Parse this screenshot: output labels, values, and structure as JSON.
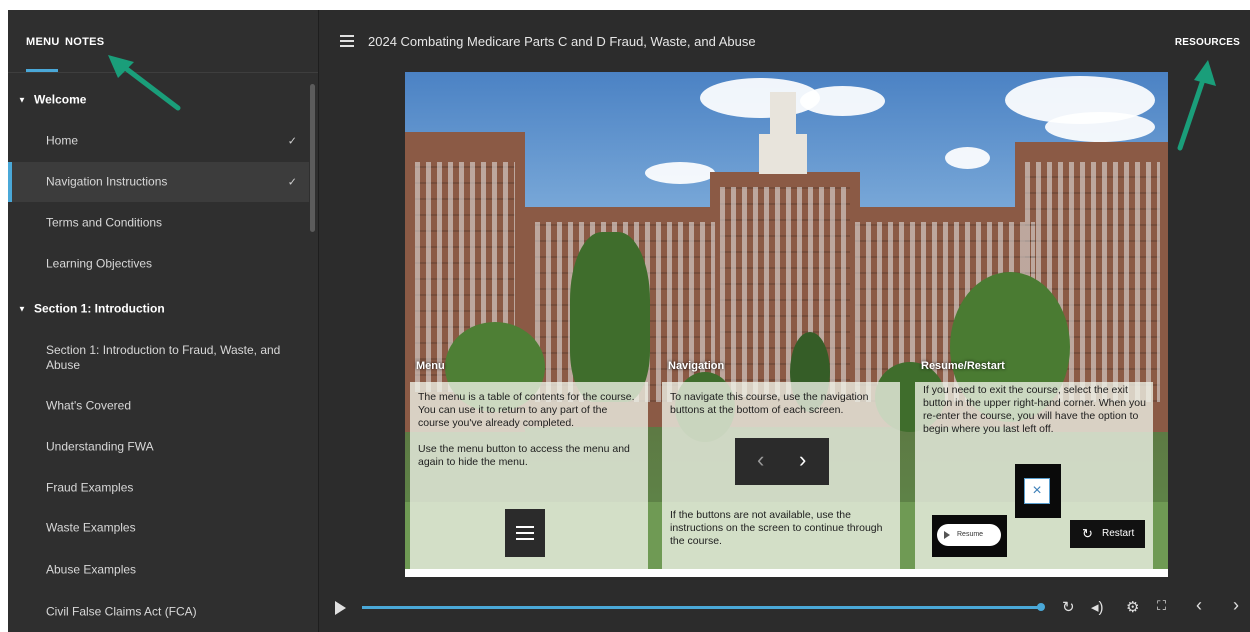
{
  "sidebar": {
    "tabs": [
      "MENU",
      "NOTES"
    ],
    "items": [
      {
        "label": "Welcome",
        "type": "section"
      },
      {
        "label": "Home",
        "type": "item",
        "completed": true
      },
      {
        "label": "Navigation Instructions",
        "type": "item",
        "completed": true,
        "active": true
      },
      {
        "label": "Terms and Conditions",
        "type": "item"
      },
      {
        "label": "Learning Objectives",
        "type": "item"
      },
      {
        "label": "Section 1: Introduction",
        "type": "section"
      },
      {
        "label": "Section 1: Introduction to Fraud, Waste, and Abuse",
        "type": "item"
      },
      {
        "label": "What's Covered",
        "type": "item"
      },
      {
        "label": "Understanding FWA",
        "type": "item"
      },
      {
        "label": "Fraud Examples",
        "type": "item"
      },
      {
        "label": "Waste Examples",
        "type": "item"
      },
      {
        "label": "Abuse Examples",
        "type": "item"
      },
      {
        "label": "Civil False Claims Act (FCA)",
        "type": "item"
      }
    ],
    "check_glyph": "✓"
  },
  "header": {
    "title": "2024 Combating Medicare Parts C and D Fraud, Waste, and Abuse",
    "resources_label": "RESOURCES"
  },
  "slide": {
    "columns": [
      {
        "title": "Menu",
        "paragraphs": [
          "The menu is a table of contents for the course. You can use it to return to any part of the course you've already completed.",
          "Use the menu button to access the menu and again to hide the menu."
        ]
      },
      {
        "title": "Navigation",
        "paragraphs": [
          "To navigate this course, use the navigation buttons at the bottom of each screen.",
          "If the buttons are not available, use the instructions on the screen to continue through the course."
        ]
      },
      {
        "title": "Resume/Restart",
        "paragraphs": [
          "If you need to exit the course, select the exit button in the upper right-hand corner. When you re-enter the course, you will have the option to begin where you last left off."
        ]
      }
    ],
    "resume_label": "Resume",
    "restart_label": "Restart",
    "exit_glyph": "×"
  },
  "player": {
    "progress": 1.0
  },
  "colors": {
    "accent": "#4aa8d8",
    "annotation_arrow": "#1a9e7a"
  }
}
